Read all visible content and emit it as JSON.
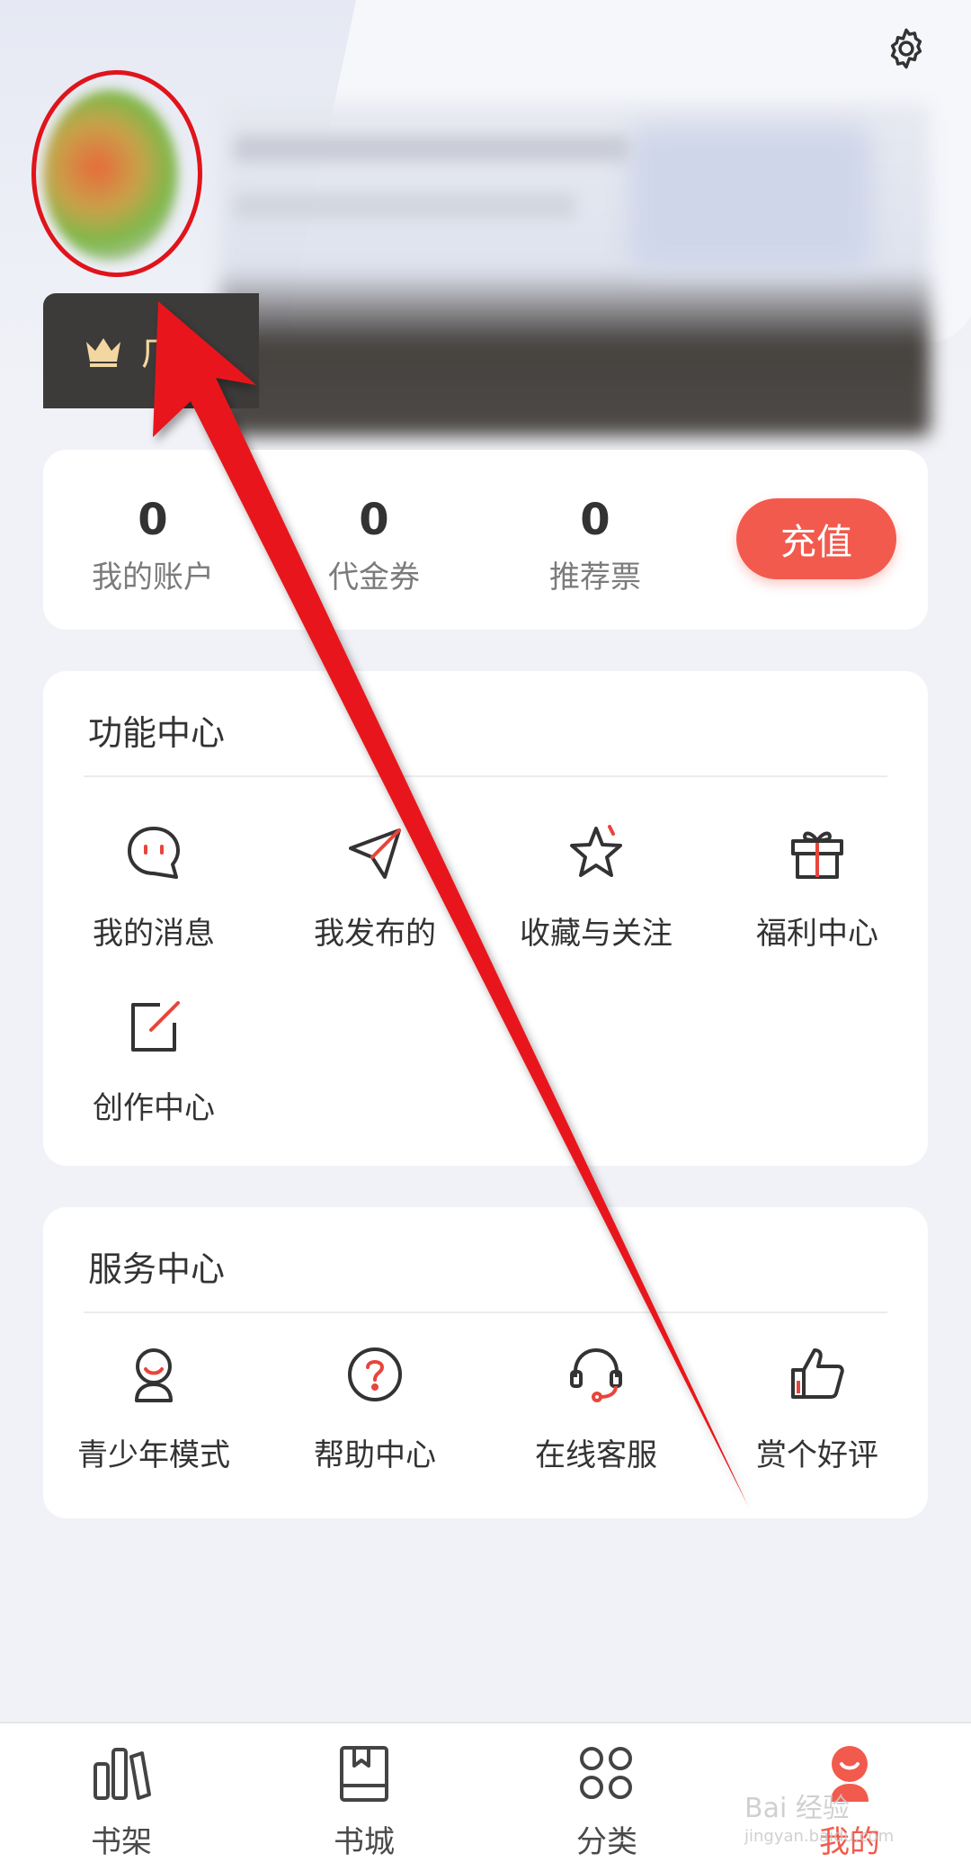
{
  "header": {
    "vip_label": "广",
    "settings_icon": "gear-icon"
  },
  "account": {
    "stats": [
      {
        "value": "0",
        "label": "我的账户"
      },
      {
        "value": "0",
        "label": "代金券"
      },
      {
        "value": "0",
        "label": "推荐票"
      }
    ],
    "recharge_label": "充值",
    "accent_color": "#f25a4d"
  },
  "function_center": {
    "title": "功能中心",
    "items": [
      {
        "label": "我的消息",
        "icon": "chat-bubble-icon"
      },
      {
        "label": "我发布的",
        "icon": "paper-plane-icon"
      },
      {
        "label": "收藏与关注",
        "icon": "star-icon"
      },
      {
        "label": "福利中心",
        "icon": "gift-icon"
      },
      {
        "label": "创作中心",
        "icon": "edit-icon"
      }
    ]
  },
  "service_center": {
    "title": "服务中心",
    "items": [
      {
        "label": "青少年模式",
        "icon": "teen-person-icon"
      },
      {
        "label": "帮助中心",
        "icon": "help-icon"
      },
      {
        "label": "在线客服",
        "icon": "headset-icon"
      },
      {
        "label": "赏个好评",
        "icon": "thumbs-up-icon"
      }
    ]
  },
  "tabbar": {
    "tabs": [
      {
        "label": "书架",
        "icon": "bookshelf-icon",
        "active": false
      },
      {
        "label": "书城",
        "icon": "bookstore-icon",
        "active": false
      },
      {
        "label": "分类",
        "icon": "category-icon",
        "active": false
      },
      {
        "label": "我的",
        "icon": "profile-icon",
        "active": true
      }
    ]
  },
  "watermark": {
    "text": "Bai 经验",
    "subtext": "jingyan.baidu.com"
  }
}
